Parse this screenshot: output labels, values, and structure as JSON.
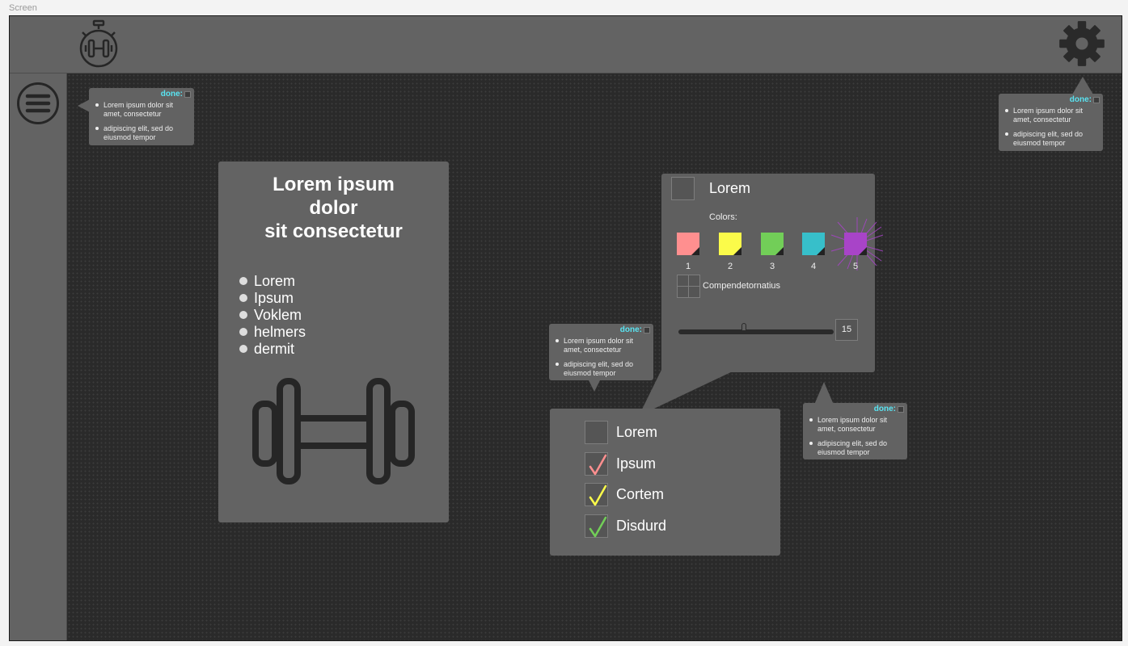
{
  "screen_label": "Screen",
  "colors": {
    "background": "#2b2b2b",
    "bars": "#636363",
    "done_accent": "#59e4f2",
    "swatches": [
      "#ff8f8f",
      "#fbfb4a",
      "#72ce58",
      "#37bfca",
      "#a844c8"
    ],
    "checks": [
      "#ff8f8f",
      "#fbfb4a",
      "#72ce58"
    ]
  },
  "topbar": {
    "logo_icon": "stopwatch-dumbbell-icon",
    "settings_icon": "gear-icon"
  },
  "sidebar": {
    "menu_icon": "hamburger-menu-icon"
  },
  "tooltips": [
    {
      "done_label": "done:",
      "items": [
        "Lorem ipsum dolor sit amet, consectetur",
        "adipiscing elit, sed do eiusmod tempor"
      ]
    },
    {
      "done_label": "done:",
      "items": [
        "Lorem ipsum dolor sit amet, consectetur",
        "adipiscing elit, sed do eiusmod tempor"
      ]
    },
    {
      "done_label": "done:",
      "items": [
        "Lorem ipsum dolor sit amet, consectetur",
        "adipiscing elit, sed do eiusmod tempor"
      ]
    },
    {
      "done_label": "done:",
      "items": [
        "Lorem ipsum dolor sit amet, consectetur",
        "adipiscing elit, sed do eiusmod tempor"
      ]
    }
  ],
  "card": {
    "title": "Lorem ipsum\ndolor\nsit consectetur",
    "items": [
      "Lorem",
      "Ipsum",
      "Voklem",
      "helmers",
      "dermit"
    ],
    "icon": "dumbbell-icon"
  },
  "settings_panel": {
    "title": "Lorem",
    "colors_label": "Colors:",
    "swatch_numbers": [
      "1",
      "2",
      "3",
      "4",
      "5"
    ],
    "selected_swatch": 5,
    "grid_label": "Compendetornatius",
    "slider_value": "15",
    "slider_fraction": 0.42
  },
  "checklist": {
    "items": [
      {
        "label": "Lorem",
        "checked": false
      },
      {
        "label": "Ipsum",
        "checked": true
      },
      {
        "label": "Cortem",
        "checked": true
      },
      {
        "label": "Disdurd",
        "checked": true
      }
    ]
  }
}
